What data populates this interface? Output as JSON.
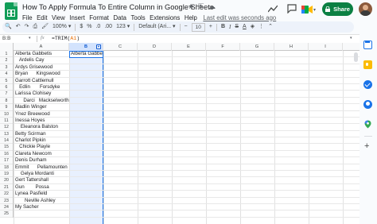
{
  "header": {
    "doc_title": "How To Apply Formula To Entire Column in Google Sheets",
    "star_icon": "★",
    "move_icon": "⇱",
    "cloud_icon": "☁",
    "last_edit": "Last edit was seconds ago",
    "share_label": "Share"
  },
  "menu": [
    "File",
    "Edit",
    "View",
    "Insert",
    "Format",
    "Data",
    "Tools",
    "Extensions",
    "Help"
  ],
  "toolbar": {
    "search": "🔍",
    "undo": "↶",
    "redo": "↷",
    "print": "⎙",
    "paint": "🖌",
    "zoom": "100%",
    "zoom_caret": "▾",
    "currency": "$",
    "percent": "%",
    "dec_decrease": ".0",
    "dec_increase": ".00",
    "number_format": "123",
    "number_caret": "▾",
    "font": "Default (Ari...",
    "font_caret": "▾",
    "font_size": "10",
    "bold": "B",
    "italic": "I",
    "strike": "S",
    "text_color": "A",
    "fill_color": "◈",
    "more": "⋮",
    "collapse": "⌃"
  },
  "formula_bar": {
    "name_box": "B:B",
    "name_caret": "▾",
    "fx": "fx",
    "formula_prefix": "=TRIM(",
    "formula_arg": "A1",
    "formula_suffix": ")",
    "expand": "▾"
  },
  "grid": {
    "columns": [
      "A",
      "B",
      "C",
      "D",
      "E",
      "F",
      "G",
      "H",
      "I"
    ],
    "col_b_dropdown": "▾",
    "rows": [
      "1",
      "2",
      "3",
      "4",
      "5",
      "6",
      "7",
      "8",
      "9",
      "10",
      "11",
      "12",
      "13",
      "14",
      "15",
      "16",
      "17",
      "18",
      "19",
      "20",
      "21",
      "22",
      "23",
      "24",
      "25"
    ],
    "cells_a": [
      "Alberta Gabbetis",
      "   Ardelis Cay",
      "Ardys Grisewood",
      "Bryan      Kingswood",
      "Garrott Cattlemull",
      "   Edlin       Forsdyke",
      "Larissa Clohisey",
      "      Darci   Mackselworth",
      "Madlin Winger",
      "Ynez Breewood",
      "Inessa Hoyes",
      "    Eleanora Balston",
      "Betty Scirman",
      "Charlot Pipkin",
      "   Chickie Playle",
      "Clareta Newcom",
      "Denis Durham",
      "Emmit      Pellamounten",
      "    Gelya Mordanti",
      "Gert Tattershall",
      "Gun        Possa",
      "Lynea Pasfield",
      "       Neville Ashley",
      "My Sacher",
      ""
    ],
    "b1": "Alberta Gabbetis"
  },
  "side_panel": {
    "add": "+"
  },
  "colors": {
    "share": "#0b8043",
    "selection": "#1a73e8",
    "sheets_green": "#0f9d58"
  }
}
